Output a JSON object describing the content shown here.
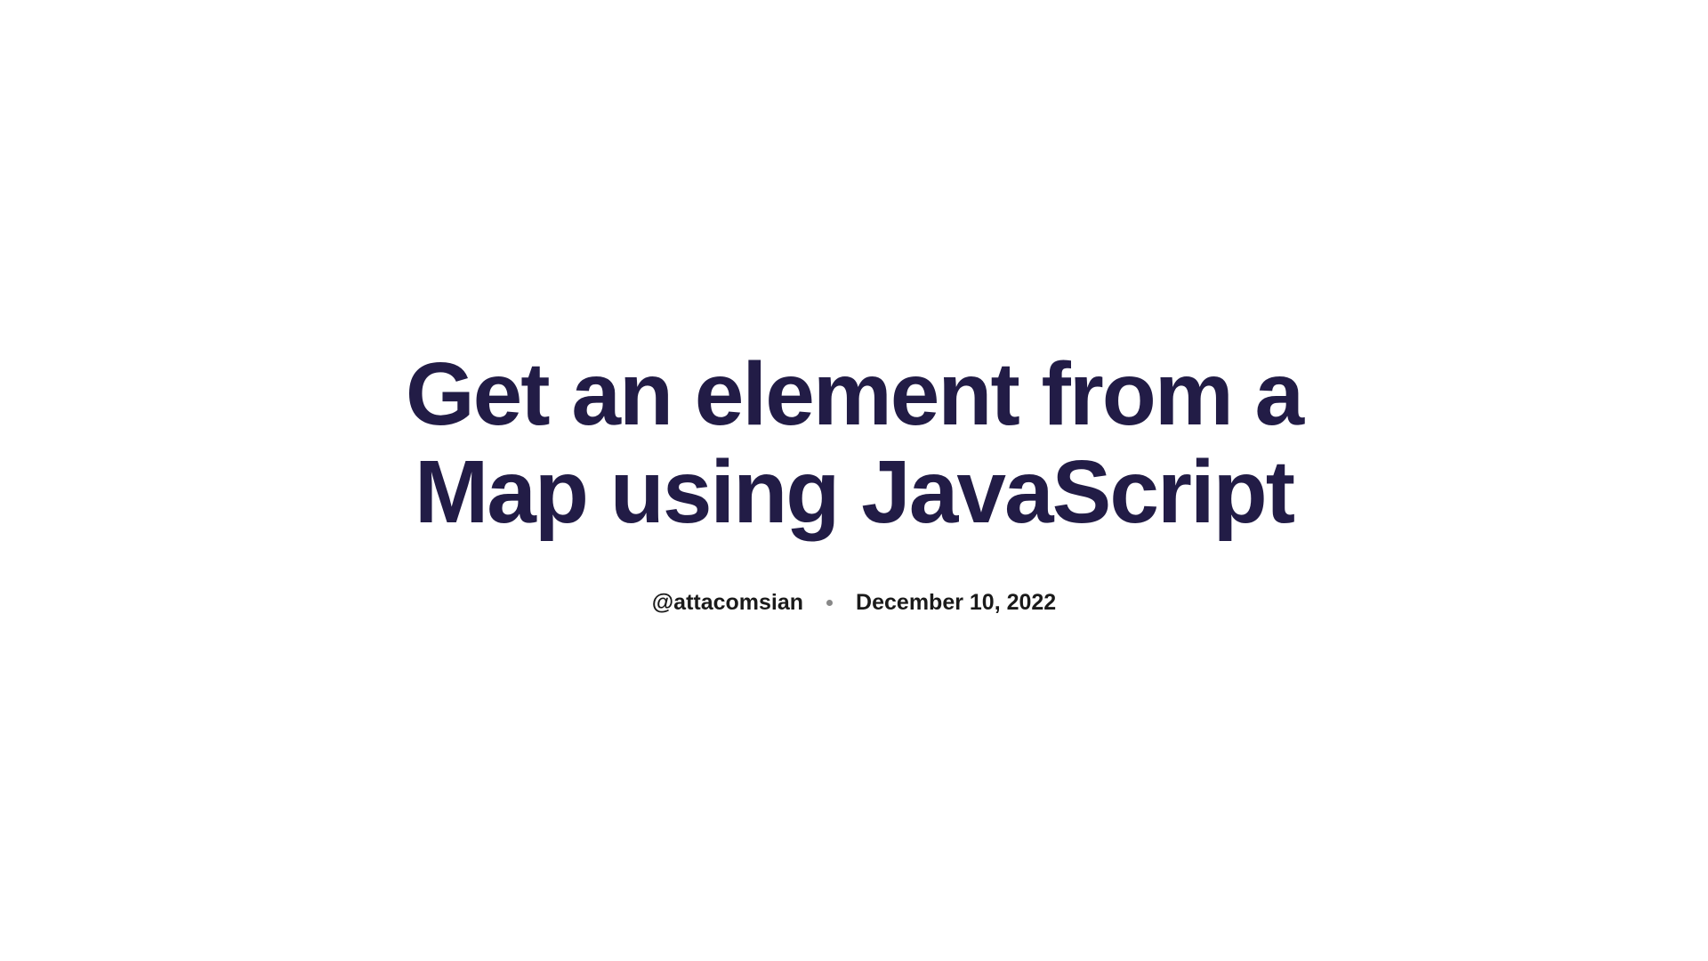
{
  "article": {
    "title": "Get an element from a Map using JavaScript",
    "author": "@attacomsian",
    "date": "December 10, 2022"
  }
}
